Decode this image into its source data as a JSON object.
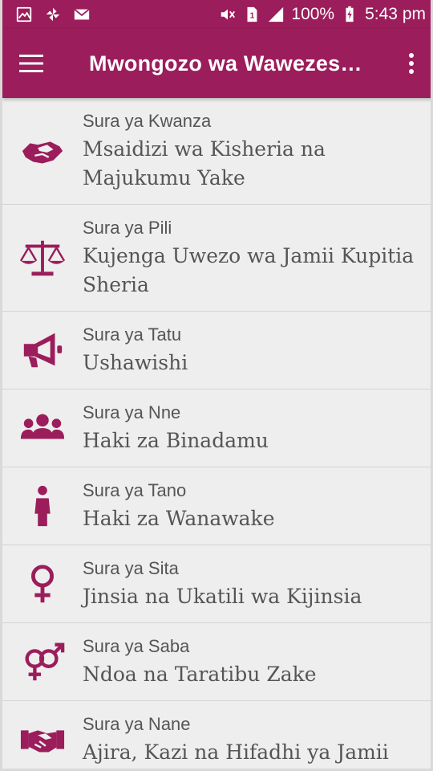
{
  "colors": {
    "primary": "#9b1d5b",
    "background": "#eeeeee",
    "text": "#555555"
  },
  "status_bar": {
    "left_icons": [
      "gallery-icon",
      "pinwheel-icon",
      "mail-icon"
    ],
    "right_icons": [
      "mute-icon",
      "sim-icon",
      "signal-icon",
      "battery-icon"
    ],
    "sim_label": "1",
    "battery": "100%",
    "time": "5:43 pm"
  },
  "app_bar": {
    "title": "Mwongozo wa Wawezes…",
    "menu_icon": "hamburger-menu-icon",
    "more_icon": "more-vert-icon"
  },
  "chapters": [
    {
      "subtitle": "Sura ya Kwanza",
      "title": "Msaidizi wa Kisheria na Majukumu Yake",
      "icon": "handshake-icon"
    },
    {
      "subtitle": "Sura ya Pili",
      "title": "Kujenga Uwezo wa Jamii Kupitia Sheria",
      "icon": "balance-scale-icon"
    },
    {
      "subtitle": "Sura ya Tatu",
      "title": "Ushawishi",
      "icon": "megaphone-icon"
    },
    {
      "subtitle": "Sura ya Nne",
      "title": "Haki za Binadamu",
      "icon": "group-icon"
    },
    {
      "subtitle": "Sura ya Tano",
      "title": "Haki za Wanawake",
      "icon": "woman-icon"
    },
    {
      "subtitle": "Sura ya Sita",
      "title": "Jinsia na Ukatili wa Kijinsia",
      "icon": "venus-icon"
    },
    {
      "subtitle": "Sura ya Saba",
      "title": "Ndoa na Taratibu Zake",
      "icon": "mars-venus-icon"
    },
    {
      "subtitle": "Sura ya Nane",
      "title": "Ajira, Kazi na Hifadhi ya Jamii",
      "icon": "business-handshake-icon"
    }
  ]
}
